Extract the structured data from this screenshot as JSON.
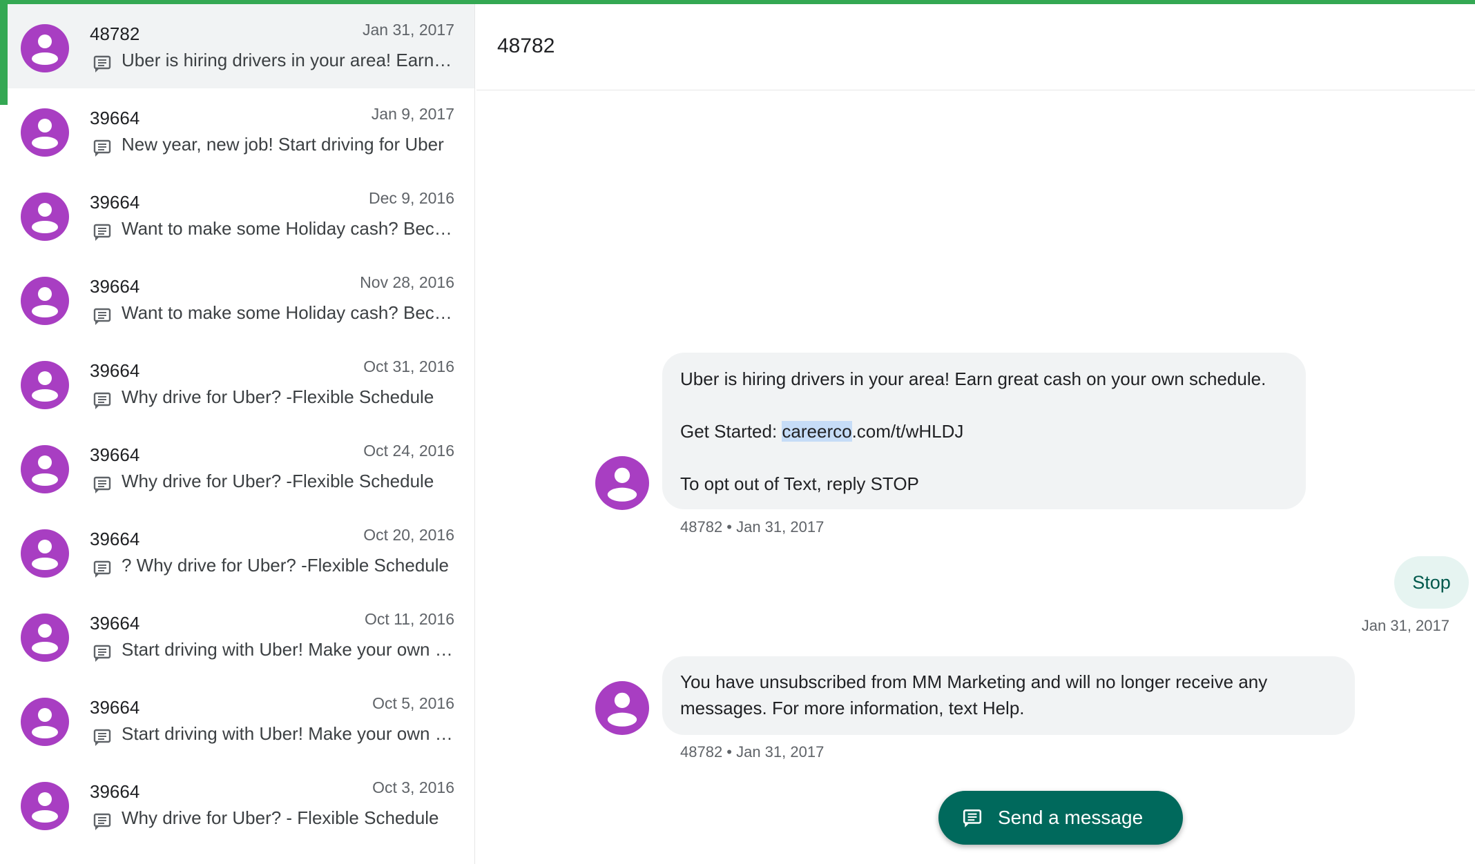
{
  "colors": {
    "accent_green": "#34a853",
    "avatar_purple": "#a83ec2",
    "send_button": "#00695c",
    "outgoing_bubble": "#e6f4f1",
    "incoming_bubble": "#f1f3f4"
  },
  "icons": {
    "avatar": "person-avatar-icon",
    "message": "message-icon",
    "send": "message-icon"
  },
  "sidebar": {
    "conversations": [
      {
        "name": "48782",
        "date": "Jan 31, 2017",
        "snippet": "Uber is hiring drivers in your area! Earn great cash on your own schedule.",
        "selected": true
      },
      {
        "name": "39664",
        "date": "Jan 9, 2017",
        "snippet": "New year, new job! Start driving for Uber"
      },
      {
        "name": "39664",
        "date": "Dec 9, 2016",
        "snippet": "Want to make some Holiday cash? Become a driver"
      },
      {
        "name": "39664",
        "date": "Nov 28, 2016",
        "snippet": "Want to make some Holiday cash? Become a driver"
      },
      {
        "name": "39664",
        "date": "Oct 31, 2016",
        "snippet": "Why drive for Uber? -Flexible Schedule"
      },
      {
        "name": "39664",
        "date": "Oct 24, 2016",
        "snippet": "Why drive for Uber? -Flexible Schedule"
      },
      {
        "name": "39664",
        "date": "Oct 20, 2016",
        "snippet": "? Why drive for Uber? -Flexible Schedule"
      },
      {
        "name": "39664",
        "date": "Oct 11, 2016",
        "snippet": "Start driving with Uber! Make your own schedule"
      },
      {
        "name": "39664",
        "date": "Oct 5, 2016",
        "snippet": "Start driving with Uber! Make your own schedule"
      },
      {
        "name": "39664",
        "date": "Oct 3, 2016",
        "snippet": "Why drive for Uber? - Flexible Schedule"
      }
    ]
  },
  "thread": {
    "title": "48782",
    "messages": [
      {
        "direction": "incoming",
        "line1": "Uber is hiring drivers in your area! Earn great cash on your own schedule.",
        "line2_prefix": "Get Started: ",
        "line2_highlight": "careerco",
        "line2_suffix": ".com/t/wHLDJ",
        "line3": "To opt out of Text, reply STOP",
        "meta": "48782 • Jan 31, 2017"
      },
      {
        "direction": "outgoing",
        "text": "Stop",
        "meta": "Jan 31, 2017"
      },
      {
        "direction": "incoming",
        "text": "You have unsubscribed from MM Marketing and will no longer receive any messages. For more information, text Help.",
        "meta": "48782 • Jan 31, 2017"
      }
    ]
  },
  "send_button": {
    "label": "Send a message"
  }
}
